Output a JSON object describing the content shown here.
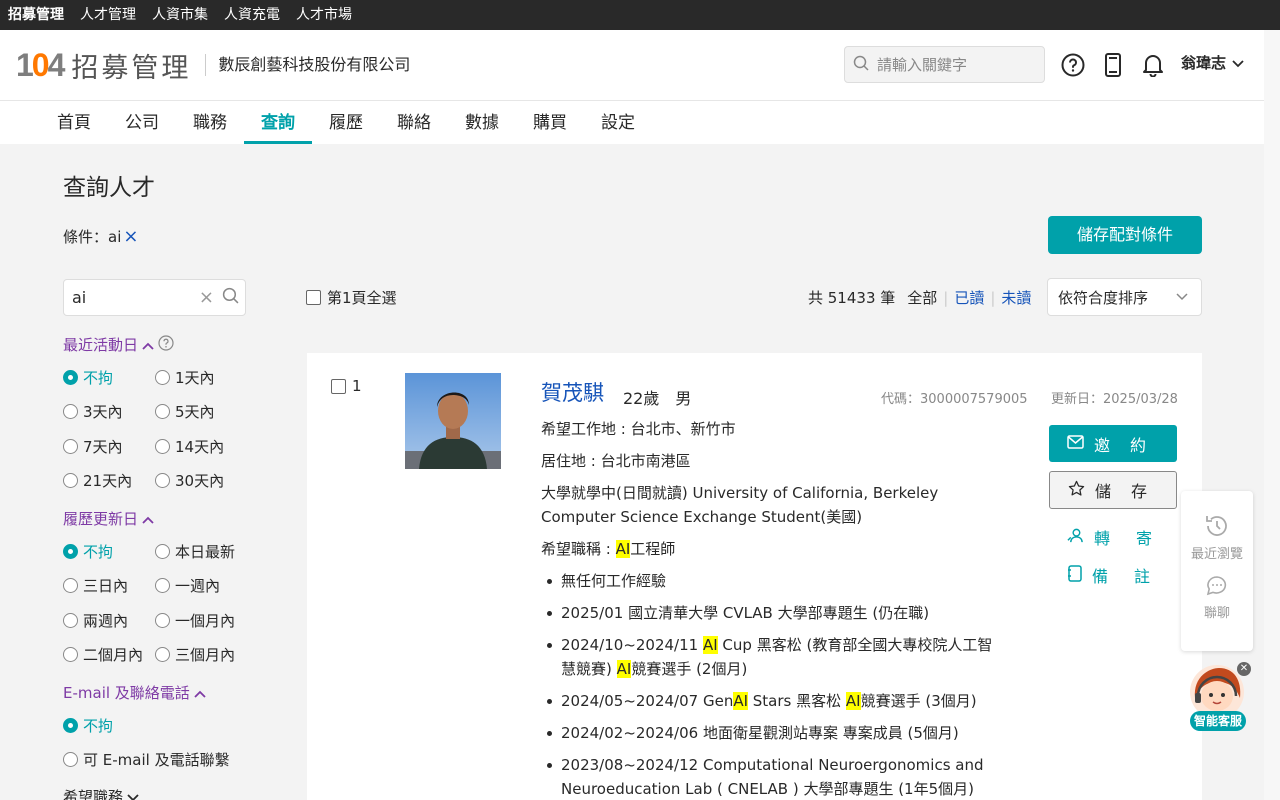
{
  "topbar": {
    "items": [
      "招募管理",
      "人才管理",
      "人資市集",
      "人資充電",
      "人才市場"
    ]
  },
  "header": {
    "logo_title": "招募管理",
    "company": "數辰創藝科技股份有限公司",
    "search_placeholder": "請輸入關鍵字",
    "user": "翁瑋志"
  },
  "nav": {
    "tabs": [
      "首頁",
      "公司",
      "職務",
      "查詢",
      "履歷",
      "聯絡",
      "數據",
      "購買",
      "設定"
    ],
    "active": "查詢"
  },
  "page": {
    "title": "查詢人才",
    "condition_label": "條件：ai",
    "save_condition": "儲存配對條件",
    "keyword": "ai"
  },
  "filters": {
    "recent_activity": {
      "title": "最近活動日",
      "options": [
        "不拘",
        "1天內",
        "3天內",
        "5天內",
        "7天內",
        "14天內",
        "21天內",
        "30天內"
      ],
      "selected": "不拘"
    },
    "resume_update": {
      "title": "履歷更新日",
      "options": [
        "不拘",
        "本日最新",
        "三日內",
        "一週內",
        "兩週內",
        "一個月內",
        "二個月內",
        "三個月內"
      ],
      "selected": "不拘"
    },
    "contact": {
      "title": "E-mail 及聯絡電話",
      "options": [
        "不拘",
        "可 E-mail 及電話聯繫"
      ],
      "selected": "不拘"
    },
    "desired_job": {
      "title": "希望職務"
    }
  },
  "results": {
    "select_all": "第1頁全選",
    "total": "共 51433 筆",
    "all": "全部",
    "read": "已讀",
    "unread": "未讀",
    "sort": "依符合度排序"
  },
  "card": {
    "index": "1",
    "name": "賀茂騏",
    "age_gender": "22歲　男",
    "code": "代碼：3000007579005",
    "updated": "更新日：2025/03/28",
    "work_location": "希望工作地 : 台北市、新竹市",
    "residence": "居住地 : 台北市南港區",
    "education_1": "大學就學中(日間就讀) University of California, Berkeley",
    "education_2": "Computer Science Exchange Student(美國)",
    "desired_title_prefix": "希望職稱 : ",
    "desired_title_hl": "AI",
    "desired_title_suffix": "工程師",
    "experience": [
      {
        "parts": [
          {
            "t": "無任何工作經驗"
          }
        ]
      },
      {
        "parts": [
          {
            "t": "2025/01 國立清華大學 CVLAB 大學部專題生 (仍在職)"
          }
        ]
      },
      {
        "parts": [
          {
            "t": "2024/10~2024/11 "
          },
          {
            "t": "AI",
            "hl": true
          },
          {
            "t": " Cup 黑客松 (教育部全國大專校院人工智慧競賽) "
          },
          {
            "t": "AI",
            "hl": true
          },
          {
            "t": "競賽選手 (2個月)"
          }
        ]
      },
      {
        "parts": [
          {
            "t": "2024/05~2024/07 Gen"
          },
          {
            "t": "AI",
            "hl": true
          },
          {
            "t": " Stars 黑客松 "
          },
          {
            "t": "AI",
            "hl": true
          },
          {
            "t": "競賽選手 (3個月)"
          }
        ]
      },
      {
        "parts": [
          {
            "t": "2024/02~2024/06 地面衛星觀測站專案 專案成員 (5個月)"
          }
        ]
      },
      {
        "parts": [
          {
            "t": "2023/08~2024/12 Computational Neuroergonomics and Neuroeducation Lab ( CNELAB ) 大學部專題生 (1年5個月)"
          }
        ]
      }
    ],
    "btn_invite": "邀約",
    "btn_save": "儲存",
    "forward": "轉寄",
    "note": "備註"
  },
  "side": {
    "recent": "最近瀏覽",
    "chat": "聯聊",
    "bot": "智能客服"
  },
  "colors": {
    "accent": "#00a1aa",
    "link": "#1654b9",
    "filter": "#7e3aa5",
    "topbar": "#292929"
  }
}
